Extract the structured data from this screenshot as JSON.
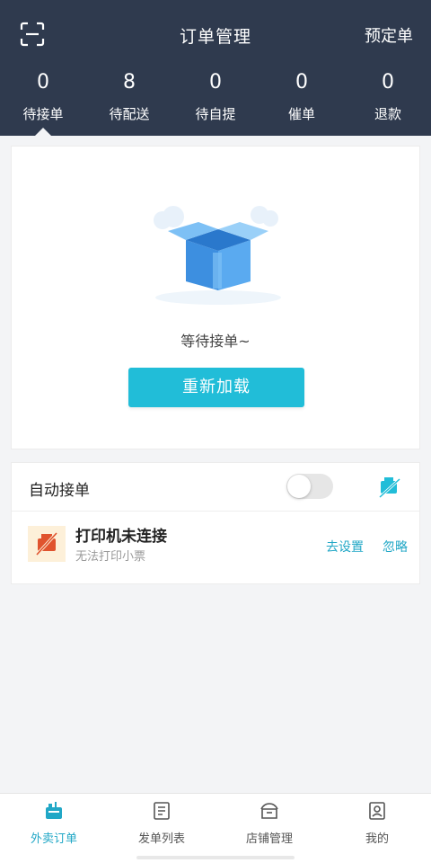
{
  "colors": {
    "header_bg": "#2f3a4e",
    "accent": "#21bdd8",
    "link": "#21a7c6"
  },
  "header": {
    "title": "订单管理",
    "right_action": "预定单",
    "scan_icon": "scan-icon"
  },
  "stats": [
    {
      "count": "0",
      "label": "待接单",
      "active": true
    },
    {
      "count": "8",
      "label": "待配送",
      "active": false
    },
    {
      "count": "0",
      "label": "待自提",
      "active": false
    },
    {
      "count": "0",
      "label": "催单",
      "active": false
    },
    {
      "count": "0",
      "label": "退款",
      "active": false
    }
  ],
  "empty_state": {
    "message": "等待接单~",
    "reload_label": "重新加载",
    "illustration": "open-box-icon"
  },
  "auto_accept": {
    "label": "自动接单",
    "enabled": false
  },
  "printer": {
    "title": "打印机未连接",
    "subtitle": "无法打印小票",
    "settings_link": "去设置",
    "ignore_link": "忽略",
    "icon": "printer-disconnected-icon"
  },
  "bottom_nav": [
    {
      "label": "外卖订单",
      "icon": "takeout-icon",
      "active": true
    },
    {
      "label": "发单列表",
      "icon": "order-list-icon",
      "active": false
    },
    {
      "label": "店铺管理",
      "icon": "store-icon",
      "active": false
    },
    {
      "label": "我的",
      "icon": "profile-icon",
      "active": false
    }
  ]
}
